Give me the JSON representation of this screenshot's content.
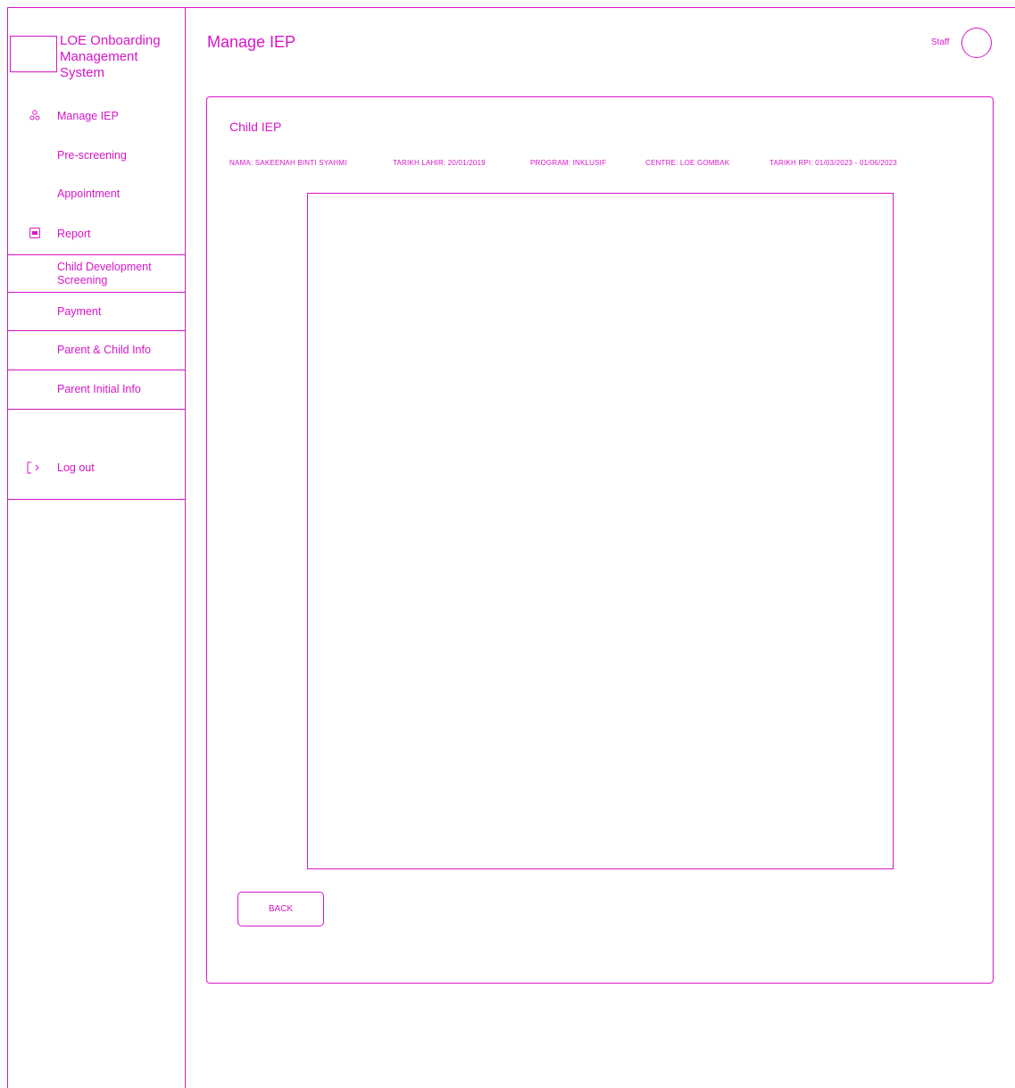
{
  "app": {
    "title": "LOE Onboarding Management System"
  },
  "sidebar": {
    "items": [
      {
        "label": "Manage IEP",
        "icon": "user-group-icon"
      },
      {
        "label": "Pre-screening"
      },
      {
        "label": "Appointment"
      },
      {
        "label": "Report",
        "icon": "report-icon"
      },
      {
        "label": "Child Development Screening"
      },
      {
        "label": "Payment"
      },
      {
        "label": "Parent & Child Info"
      },
      {
        "label": "Parent Initial Info"
      },
      {
        "label": "Log out",
        "icon": "logout-icon"
      }
    ]
  },
  "header": {
    "title": "Manage IEP",
    "user_role": "Staff"
  },
  "card": {
    "title": "Child IEP",
    "info": {
      "nama": "NAMA: SAKEENAH BINTI SYAHMI",
      "tarikh_lahir": "TARIKH LAHIR: 20/01/2019",
      "program": "PROGRAM: INKLUSIF",
      "centre": "CENTRE: LOE GOMBAK",
      "tarikh_rpi": "TARIKH RPI: 01/03/2023 - 01/06/2023"
    },
    "back_label": "BACK"
  },
  "colors": {
    "accent": "#d616c9",
    "background": "#ffffff"
  }
}
